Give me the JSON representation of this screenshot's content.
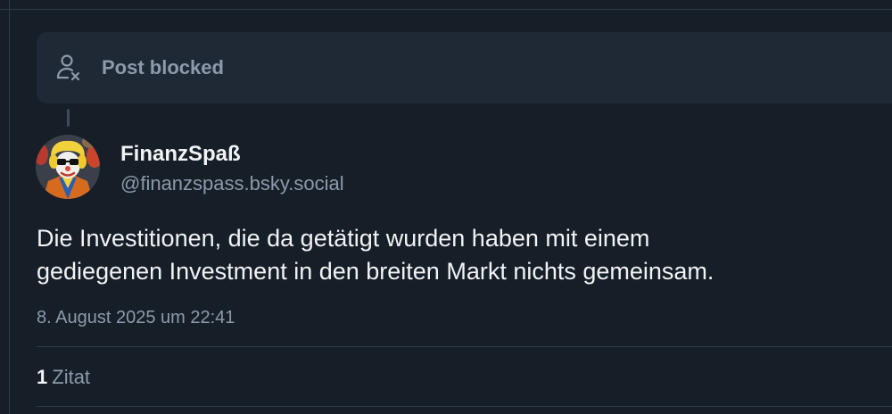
{
  "blocked": {
    "label": "Post blocked",
    "icon": "user-blocked-icon"
  },
  "post": {
    "author": {
      "display_name": "FinanzSpaß",
      "handle": "@finanzspass.bsky.social",
      "avatar": "clown-avatar"
    },
    "text_lines": [
      "Die Investitionen, die da getätigt wurden haben mit einem",
      "gediegenen Investment in den breiten Markt nichts gemeinsam."
    ],
    "timestamp": "8. August 2025 um 22:41",
    "stats": {
      "quote_count": "1",
      "quote_label": "Zitat"
    }
  },
  "colors": {
    "background": "#161e27",
    "card": "#1e2935",
    "text_primary": "#f1f3f5",
    "text_secondary": "#8d9aab",
    "divider": "#2e3a48"
  }
}
